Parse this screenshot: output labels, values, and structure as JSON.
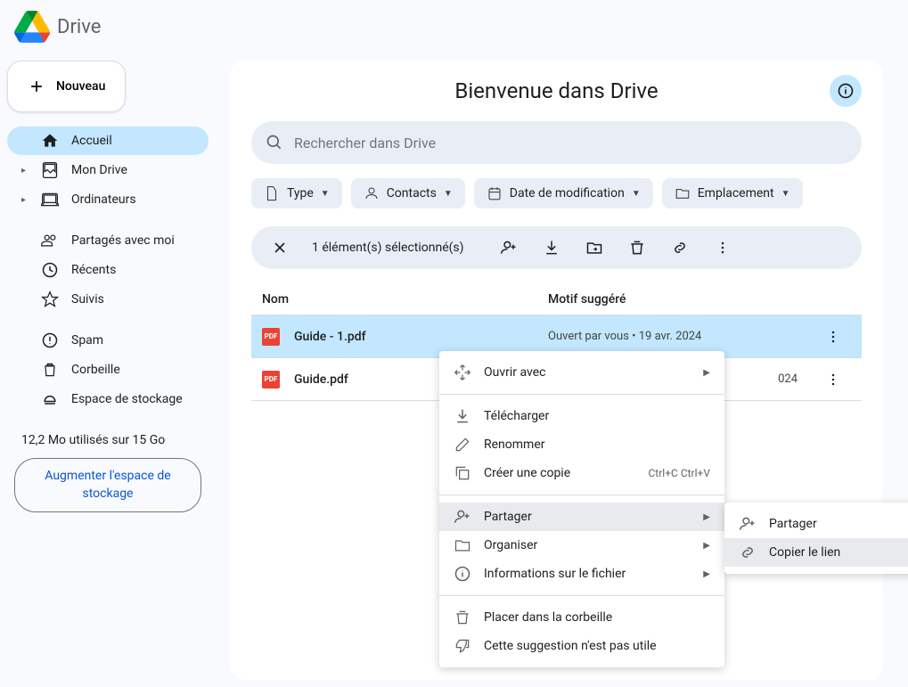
{
  "app": {
    "name": "Drive"
  },
  "sidebar": {
    "new_label": "Nouveau",
    "items": [
      {
        "label": "Accueil",
        "icon": "home-icon",
        "active": true
      },
      {
        "label": "Mon Drive",
        "icon": "drive-icon",
        "expandable": true
      },
      {
        "label": "Ordinateurs",
        "icon": "computer-icon",
        "expandable": true
      }
    ],
    "items2": [
      {
        "label": "Partagés avec moi",
        "icon": "shared-icon"
      },
      {
        "label": "Récents",
        "icon": "recent-icon"
      },
      {
        "label": "Suivis",
        "icon": "starred-icon"
      }
    ],
    "items3": [
      {
        "label": "Spam",
        "icon": "spam-icon"
      },
      {
        "label": "Corbeille",
        "icon": "trash-icon"
      },
      {
        "label": "Espace de stockage",
        "icon": "storage-icon"
      }
    ],
    "storage_text": "12,2 Mo utilisés sur 15 Go",
    "storage_btn": "Augmenter l'espace de stockage"
  },
  "main": {
    "title": "Bienvenue dans Drive",
    "search_placeholder": "Rechercher dans Drive",
    "chips": [
      {
        "label": "Type",
        "icon": "file-icon"
      },
      {
        "label": "Contacts",
        "icon": "person-icon"
      },
      {
        "label": "Date de modification",
        "icon": "calendar-icon"
      },
      {
        "label": "Emplacement",
        "icon": "folder-icon"
      }
    ],
    "selection_text": "1 élément(s) sélectionné(s)",
    "columns": {
      "name": "Nom",
      "reason": "Motif suggéré"
    },
    "files": [
      {
        "name": "Guide - 1.pdf",
        "reason": "Ouvert par vous • 19 avr. 2024",
        "selected": true
      },
      {
        "name": "Guide.pdf",
        "reason": "024",
        "selected": false
      }
    ]
  },
  "context_menu": {
    "open_with": "Ouvrir avec",
    "download": "Télécharger",
    "rename": "Renommer",
    "copy": "Créer une copie",
    "copy_shortcut": "Ctrl+C Ctrl+V",
    "share": "Partager",
    "organize": "Organiser",
    "file_info": "Informations sur le fichier",
    "trash": "Placer dans la corbeille",
    "not_useful": "Cette suggestion n'est pas utile"
  },
  "share_submenu": {
    "share": "Partager",
    "copy_link": "Copier le lien"
  }
}
